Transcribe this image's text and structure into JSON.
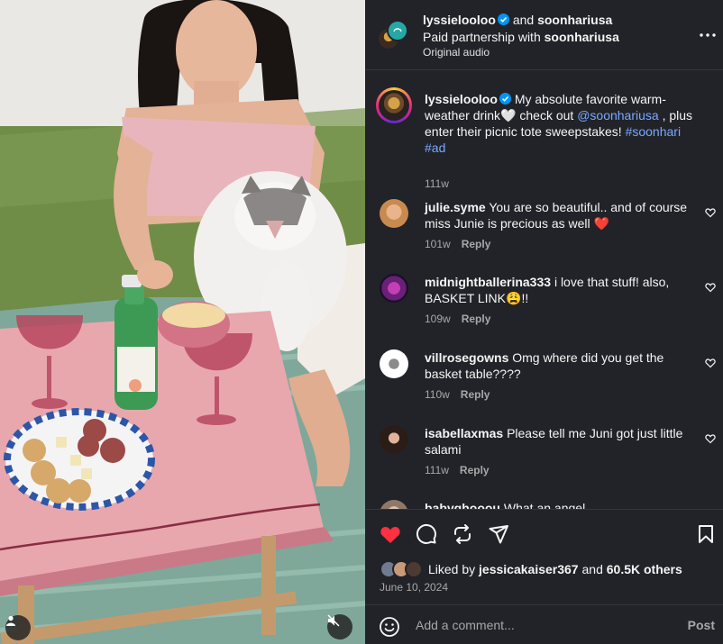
{
  "header": {
    "author": "lyssielooloo",
    "connector": "and",
    "coauthor": "soonhariusa",
    "partnership_prefix": "Paid partnership with",
    "partner": "soonhariusa",
    "audio": "Original audio"
  },
  "caption": {
    "username": "lyssielooloo",
    "text_1": "My absolute favorite warm-weather drink",
    "heart_emoji": "🤍",
    "text_2": "check out",
    "mention": "@soonhariusa",
    "text_3": ", plus enter their picnic tote sweepstakes!",
    "hashtag_1": "#soonhari",
    "hashtag_2": "#ad",
    "age": "111w"
  },
  "comments": [
    {
      "username": "julie.syme",
      "text": "You are so beautiful.. and of course miss Junie is precious as well",
      "emoji": "❤️",
      "age": "101w",
      "reply_label": "Reply"
    },
    {
      "username": "midnightballerina333",
      "text": "i love that stuff! also, BASKET LINK",
      "emoji": "😩!!",
      "age": "109w",
      "reply_label": "Reply"
    },
    {
      "username": "villrosegowns",
      "text": "Omg where did you get the basket table????",
      "emoji": "",
      "age": "110w",
      "reply_label": "Reply"
    },
    {
      "username": "isabellaxmas",
      "text": "Please tell me Juni got just little salami",
      "emoji": "",
      "age": "111w",
      "reply_label": "Reply"
    },
    {
      "username": "babyghooou",
      "text": "What an angel",
      "emoji": "",
      "age": "",
      "reply_label": ""
    }
  ],
  "likes": {
    "prefix": "Liked by",
    "user": "jessicakaiser367",
    "connector": "and",
    "count": "60.5K others"
  },
  "date": "June 10, 2024",
  "comment_box": {
    "placeholder": "Add a comment...",
    "post_label": "Post"
  },
  "colors": {
    "panel_bg": "#212328",
    "link": "#7aa8ff",
    "like_red": "#ff3040",
    "verified_blue": "#0095f6",
    "muted": "#a8a8a8"
  }
}
